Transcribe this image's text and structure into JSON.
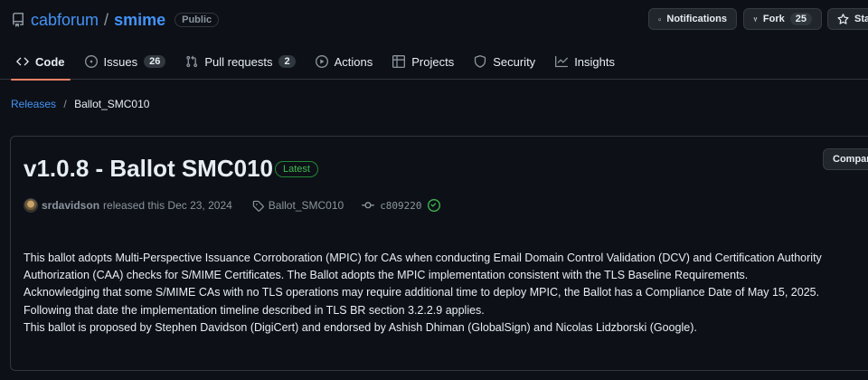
{
  "repo": {
    "owner": "cabforum",
    "separator": "/",
    "name": "smime",
    "visibility": "Public"
  },
  "header_actions": {
    "notifications_label": "Notifications",
    "fork_label": "Fork",
    "fork_count": "25",
    "star_label": "Sta"
  },
  "nav": {
    "tabs": [
      {
        "label": "Code",
        "icon": "code-icon",
        "selected": true
      },
      {
        "label": "Issues",
        "icon": "issue-opened-icon",
        "count": "26"
      },
      {
        "label": "Pull requests",
        "icon": "git-pull-request-icon",
        "count": "2"
      },
      {
        "label": "Actions",
        "icon": "play-icon"
      },
      {
        "label": "Projects",
        "icon": "table-icon"
      },
      {
        "label": "Security",
        "icon": "shield-icon"
      },
      {
        "label": "Insights",
        "icon": "graph-icon"
      }
    ]
  },
  "breadcrumb": {
    "parent": "Releases",
    "separator": "/",
    "current": "Ballot_SMC010"
  },
  "release": {
    "title": "v1.0.8 - Ballot SMC010",
    "badge": "Latest",
    "compare_label": "Compare",
    "author": "srdavidson",
    "released_text": "released this Dec 23, 2024",
    "tag": "Ballot_SMC010",
    "commit_sha": "c809220",
    "notes": [
      "This ballot adopts Multi-Perspective Issuance Corroboration (MPIC) for CAs when conducting Email Domain Control Validation (DCV) and Certification Authority",
      "Authorization (CAA) checks for S/MIME Certificates. The Ballot adopts the MPIC implementation consistent with the TLS Baseline Requirements.",
      "Acknowledging that some S/MIME CAs with no TLS operations may require additional time to deploy MPIC, the Ballot has a Compliance Date of May 15, 2025.",
      "Following that date the implementation timeline described in TLS BR section 3.2.2.9 applies.",
      "This ballot is proposed by Stephen Davidson (DigiCert) and endorsed by Ashish Dhiman (GlobalSign) and Nicolas Lidzborski (Google)."
    ]
  },
  "colors": {
    "background": "#0d1117",
    "link": "#4493f8",
    "tab_underline": "#f78166",
    "latest_green": "#3fb950"
  }
}
